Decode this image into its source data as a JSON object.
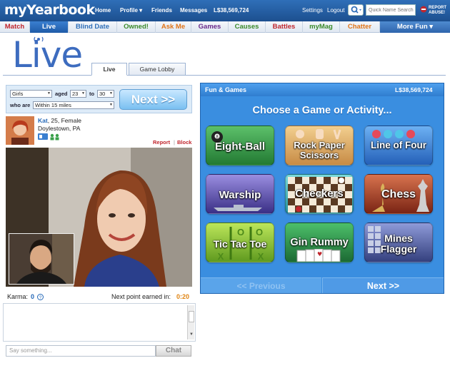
{
  "header": {
    "logo": "myYearbook",
    "nav": [
      "Home",
      "Profile ▾",
      "Friends",
      "Messages"
    ],
    "balance": "L$38,569,724",
    "settings": "Settings",
    "logout": "Logout",
    "search_placeholder": "Quick Name Search",
    "report_line1": "REPORT",
    "report_line2": "ABUSE!"
  },
  "tabs": [
    {
      "label": "Match",
      "color": "#c0262d"
    },
    {
      "label": "Live",
      "color": "#ffffff"
    },
    {
      "label": "Blind Date",
      "color": "#2f6fb8"
    },
    {
      "label": "Owned!",
      "color": "#3a8a2a"
    },
    {
      "label": "Ask Me",
      "color": "#e07418"
    },
    {
      "label": "Games",
      "color": "#6a2a8a"
    },
    {
      "label": "Causes",
      "color": "#3a8a2a"
    },
    {
      "label": "Battles",
      "color": "#c0262d"
    },
    {
      "label": "myMag",
      "color": "#3a8a2a"
    },
    {
      "label": "Chatter",
      "color": "#e07418"
    },
    {
      "label": "More Fun ▾",
      "color": "#ffffff"
    }
  ],
  "live": {
    "logo": "Live",
    "subtabs": [
      "Live",
      "Game Lobby"
    ]
  },
  "filters": {
    "gender": "Girls",
    "aged_label": "aged",
    "age_min": "23",
    "to_label": "to",
    "age_max": "30",
    "who_are_label": "who are",
    "distance": "Within 15 miles",
    "next_label": "Next >>"
  },
  "profile": {
    "name": "Kat",
    "details": ", 25, Female",
    "location": "Doylestown, PA",
    "report": "Report",
    "block": "Block"
  },
  "stats": {
    "karma_label": "Karma:",
    "karma_value": "0",
    "next_point_label": "Next point earned in:",
    "next_point_value": "0:20"
  },
  "chat": {
    "placeholder": "Say something...",
    "button": "Chat"
  },
  "games": {
    "title": "Fun & Games",
    "credits": "L$38,569,724",
    "prompt": "Choose a Game or Activity...",
    "items": [
      {
        "line1": "Eight-Ball",
        "line2": "",
        "bg": "#2f8a3a"
      },
      {
        "line1": "Rock Paper",
        "line2": "Scissors",
        "bg": "#d8a25a"
      },
      {
        "line1": "Line of Four",
        "line2": "",
        "bg": "#3a7fd8"
      },
      {
        "line1": "Warship",
        "line2": "",
        "bg": "#5a4aa8"
      },
      {
        "line1": "Checkers",
        "line2": "",
        "bg": "#2fa8a8"
      },
      {
        "line1": "Chess",
        "line2": "",
        "bg": "#a83a2a"
      },
      {
        "line1": "Tic Tac Toe",
        "line2": "",
        "bg": "#8fc83a"
      },
      {
        "line1": "Gin Rummy",
        "line2": "",
        "bg": "#2f8a4a"
      },
      {
        "line1": "Mines",
        "line2": "Flagger",
        "bg": "#5a6aa8"
      }
    ],
    "previous": "<< Previous",
    "next": "Next >>"
  }
}
